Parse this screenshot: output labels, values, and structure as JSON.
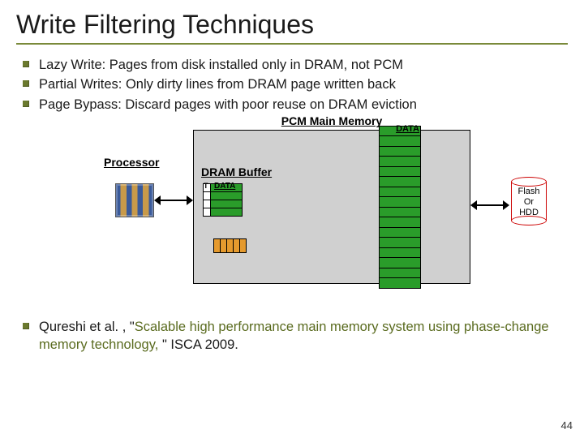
{
  "title": "Write Filtering Techniques",
  "bullets_top": [
    "Lazy Write: Pages from disk installed only in DRAM, not PCM",
    "Partial Writes:  Only dirty lines from DRAM page written back",
    "Page Bypass: Discard pages with poor reuse on DRAM eviction"
  ],
  "diagram": {
    "pcm_label": "PCM Main Memory",
    "pcm_data_label": "DATA",
    "dram_label": "DRAM Buffer",
    "dram_data_label": "DATA",
    "tag_label": "T",
    "processor_label": "Processor",
    "disk_lines": [
      "Flash",
      "Or",
      "HDD"
    ]
  },
  "citation": {
    "prefix": "Qureshi et al. , \"",
    "title": "Scalable high performance main memory system using phase-change memory technology, ",
    "suffix": "\" ISCA 2009."
  },
  "page_number": "44"
}
